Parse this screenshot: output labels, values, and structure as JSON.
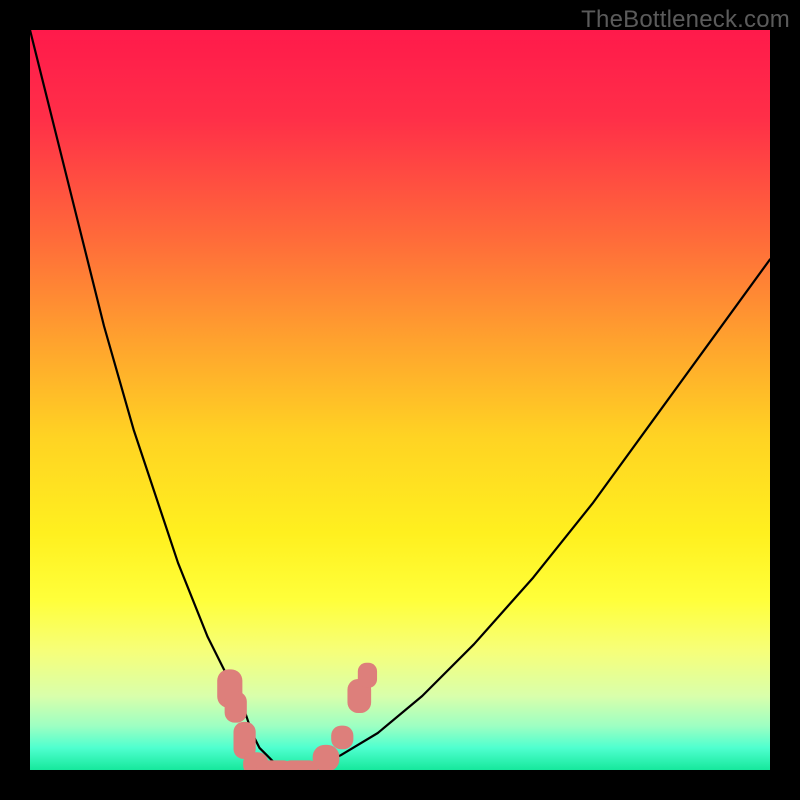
{
  "watermark": "TheBottleneck.com",
  "chart_data": {
    "type": "line",
    "title": "",
    "xlabel": "",
    "ylabel": "",
    "xlim": [
      0,
      100
    ],
    "ylim": [
      0,
      100
    ],
    "grid": false,
    "background": {
      "type": "vertical-gradient",
      "stops": [
        {
          "pos": 0,
          "color": "#ff1a4b"
        },
        {
          "pos": 12,
          "color": "#ff2f48"
        },
        {
          "pos": 28,
          "color": "#ff6a3a"
        },
        {
          "pos": 42,
          "color": "#ffa22e"
        },
        {
          "pos": 55,
          "color": "#ffd323"
        },
        {
          "pos": 68,
          "color": "#fff01f"
        },
        {
          "pos": 77,
          "color": "#ffff3a"
        },
        {
          "pos": 84,
          "color": "#f6ff7a"
        },
        {
          "pos": 90,
          "color": "#d9ffab"
        },
        {
          "pos": 94,
          "color": "#9effc2"
        },
        {
          "pos": 97,
          "color": "#4fffcf"
        },
        {
          "pos": 100,
          "color": "#16e89c"
        }
      ]
    },
    "series": [
      {
        "name": "curve",
        "stroke": "#000000",
        "stroke_width": 2.2,
        "x": [
          0,
          2,
          4,
          6,
          8,
          10,
          12,
          14,
          16,
          18,
          20,
          22,
          24,
          26,
          28,
          29,
          30,
          31,
          32,
          33,
          35,
          38,
          42,
          47,
          53,
          60,
          68,
          76,
          84,
          92,
          100
        ],
        "y": [
          100,
          92,
          84,
          76,
          68,
          60,
          53,
          46,
          40,
          34,
          28,
          23,
          18,
          14,
          10,
          8,
          5,
          3,
          2,
          1,
          0,
          0,
          2,
          5,
          10,
          17,
          26,
          36,
          47,
          58,
          69
        ]
      }
    ],
    "markers": {
      "shape": "rounded-rect",
      "color": "#dd7f7b",
      "points": [
        {
          "x": 27.0,
          "y": 11.0,
          "w": 3.4,
          "h": 5.2
        },
        {
          "x": 27.8,
          "y": 8.5,
          "w": 3.0,
          "h": 4.2
        },
        {
          "x": 29.0,
          "y": 4.0,
          "w": 3.0,
          "h": 5.0
        },
        {
          "x": 30.5,
          "y": 0.8,
          "w": 3.4,
          "h": 3.2
        },
        {
          "x": 33.0,
          "y": 0.0,
          "w": 4.8,
          "h": 2.6
        },
        {
          "x": 36.5,
          "y": 0.0,
          "w": 4.8,
          "h": 2.6
        },
        {
          "x": 40.0,
          "y": 1.6,
          "w": 3.6,
          "h": 3.6
        },
        {
          "x": 42.2,
          "y": 4.4,
          "w": 3.0,
          "h": 3.2
        },
        {
          "x": 44.5,
          "y": 10.0,
          "w": 3.2,
          "h": 4.6
        },
        {
          "x": 45.6,
          "y": 12.8,
          "w": 2.6,
          "h": 3.4
        }
      ]
    }
  }
}
